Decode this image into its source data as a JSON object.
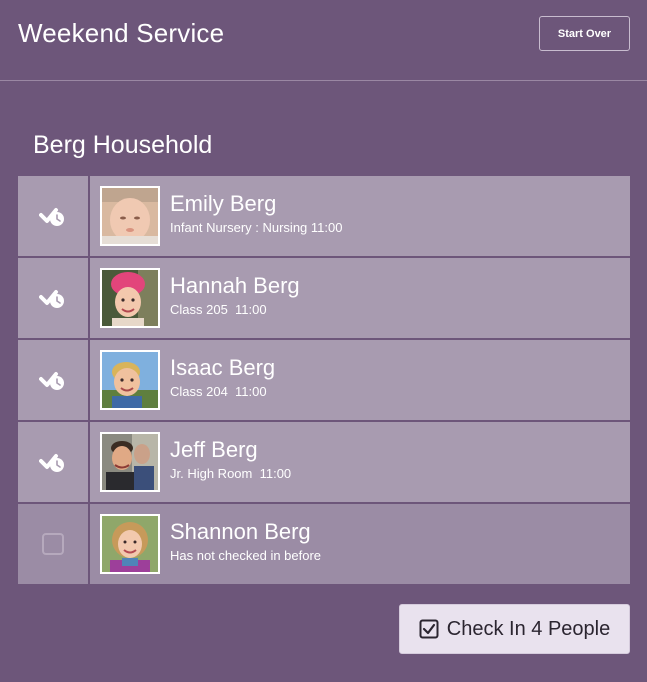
{
  "header": {
    "title": "Weekend Service",
    "start_over_label": "Start Over"
  },
  "household": {
    "title": "Berg Household"
  },
  "people": [
    {
      "name": "Emily Berg",
      "detail": "Infant Nursery : Nursing 11:00",
      "checked_in": true,
      "check_icon": "checkmark-clock-icon"
    },
    {
      "name": "Hannah Berg",
      "detail": "Class 205  11:00",
      "checked_in": true,
      "check_icon": "checkmark-clock-icon"
    },
    {
      "name": "Isaac Berg",
      "detail": "Class 204  11:00",
      "checked_in": true,
      "check_icon": "checkmark-clock-icon"
    },
    {
      "name": "Jeff Berg",
      "detail": "Jr. High Room  11:00",
      "checked_in": true,
      "check_icon": "checkmark-clock-icon"
    },
    {
      "name": "Shannon Berg",
      "detail": "Has not checked in before",
      "checked_in": false,
      "check_icon": "empty-checkbox-icon"
    }
  ],
  "footer": {
    "check_in_label": "Check In 4 People",
    "check_in_icon": "checked-box-icon"
  },
  "colors": {
    "background": "#6d567a",
    "row": "#a89bb0",
    "row_unchecked": "#9b8ca5",
    "button_bg": "#e9e2ee"
  }
}
